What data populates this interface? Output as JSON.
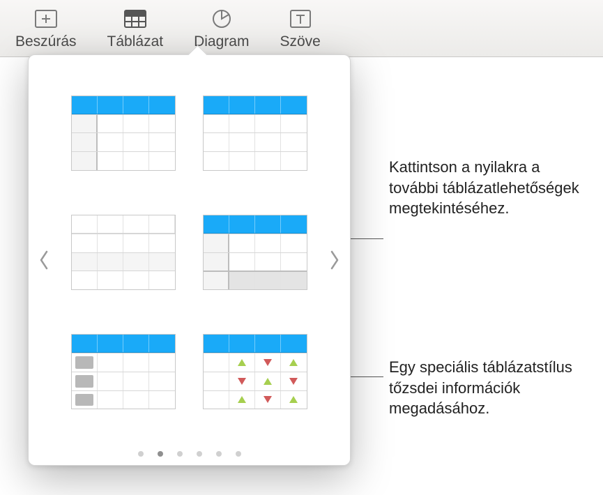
{
  "toolbar": {
    "items": [
      {
        "label": "Beszúrás",
        "icon": "insert-icon"
      },
      {
        "label": "Táblázat",
        "icon": "table-icon",
        "active": true
      },
      {
        "label": "Diagram",
        "icon": "chart-icon"
      },
      {
        "label": "Szöve",
        "icon": "text-icon"
      }
    ]
  },
  "popover": {
    "pages": {
      "count": 6,
      "active": 1
    },
    "styles": [
      {
        "id": "header-first-col",
        "kind": "blue-header"
      },
      {
        "id": "header-plain",
        "kind": "blue-header"
      },
      {
        "id": "plain-striped",
        "kind": "no-header"
      },
      {
        "id": "header-first-col-footer",
        "kind": "blue-header"
      },
      {
        "id": "header-tag-col",
        "kind": "blue-header"
      },
      {
        "id": "header-stock-arrows",
        "kind": "blue-header"
      }
    ]
  },
  "annotations": {
    "arrows": "Kattintson a nyilakra a további táblázatlehetőségek megtekintéséhez.",
    "stock": "Egy speciális táblázatstílus tőzsdei információk megadásához."
  },
  "colors": {
    "accent": "#1aaaf8",
    "up": "#a6cf4f",
    "down": "#d15a5a"
  }
}
